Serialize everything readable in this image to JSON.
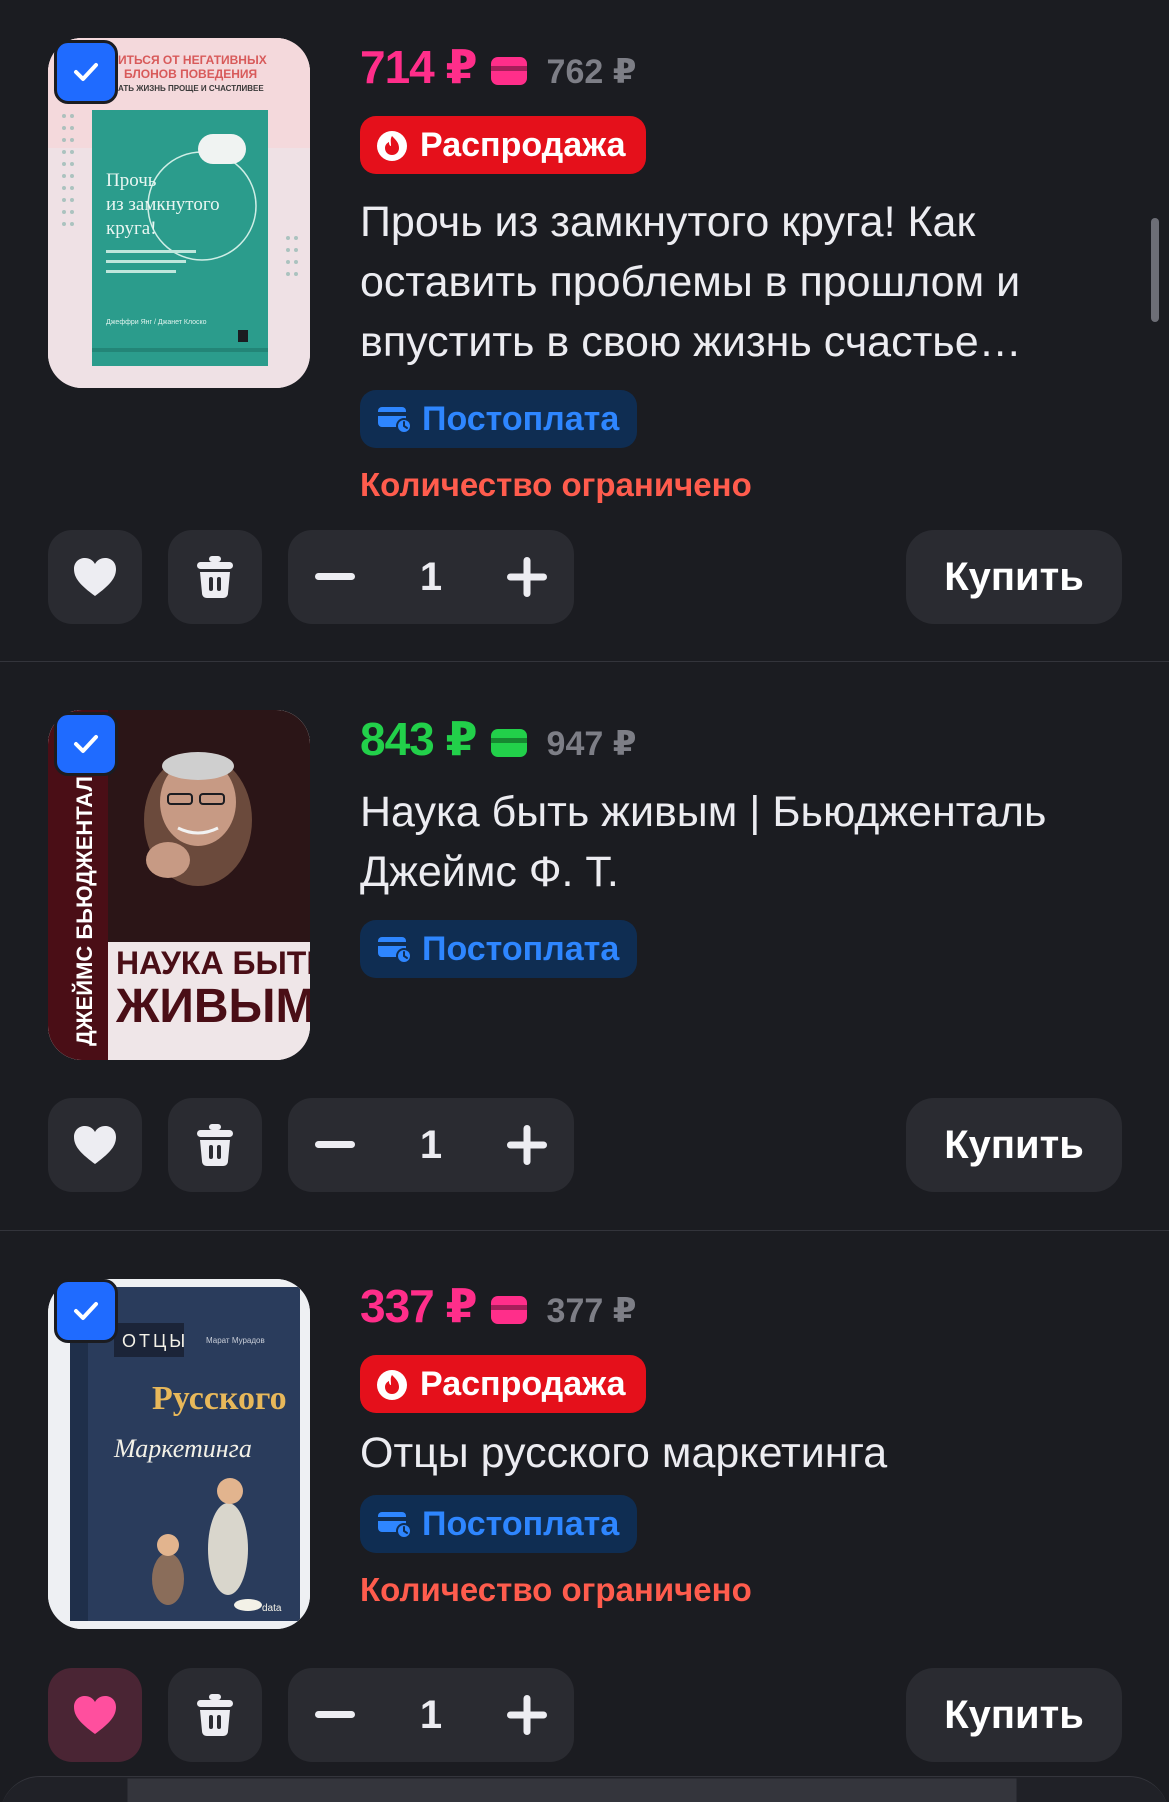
{
  "cart": {
    "items": [
      {
        "price": "714 ₽",
        "old_price": "762 ₽",
        "price_color": "#ff2e8a",
        "sale_label": "Распродажа",
        "title": "Прочь из замкнутого круга! Как оставить проблемы в прошлом и впустить в свою жизнь счастье…",
        "postpay_label": "Постоплата",
        "limited_label": "Количество ограничено",
        "quantity": "1",
        "buy_label": "Купить",
        "favorite": false,
        "selected": true,
        "cover": {
          "top_text_1": "ИТЬСЯ ОТ НЕГАТИВНЫХ",
          "top_text_2": "БЛОНОВ ПОВЕДЕНИЯ",
          "top_text_3": "АТЬ ЖИЗНЬ ПРОЩЕ И СЧАСТЛИВЕЕ",
          "title": "Прочь из замкнутого круга!",
          "authors": "Джеффри Янг / Джанет Клоско"
        }
      },
      {
        "price": "843 ₽",
        "old_price": "947 ₽",
        "price_color": "#22d04a",
        "title": "Наука быть живым | Бьюдженталь Джеймс Ф. Т.",
        "postpay_label": "Постоплата",
        "quantity": "1",
        "buy_label": "Купить",
        "favorite": false,
        "selected": true,
        "cover": {
          "spine_text": "ДЖЕЙМС БЬЮДЖЕНТАЛЬ",
          "title_1": "НАУКА БЫТЬ",
          "title_2": "ЖИВЫМ"
        }
      },
      {
        "price": "337 ₽",
        "old_price": "377 ₽",
        "price_color": "#ff2e8a",
        "sale_label": "Распродажа",
        "title": "Отцы русского маркетинга",
        "postpay_label": "Постоплата",
        "limited_label": "Количество ограничено",
        "quantity": "1",
        "buy_label": "Купить",
        "favorite": true,
        "selected": true,
        "cover": {
          "title_1": "ОТЦЫ",
          "title_2": "Русского",
          "title_3": "Маркетинга",
          "author": "Марат Мурадов",
          "publisher": "data"
        }
      }
    ]
  },
  "colors": {
    "background": "#1b1c21",
    "button_bg": "#2a2b31",
    "accent_blue": "#1f6bff",
    "sale_red": "#e5101b",
    "limited_red": "#ff5c4d",
    "postpay_blue": "#2e86ff",
    "favorite_pink": "#ff4f9e"
  },
  "icons": [
    "check-icon",
    "fire-icon",
    "wallet-icon",
    "postpay-icon",
    "heart-icon",
    "trash-icon",
    "minus-icon",
    "plus-icon"
  ]
}
